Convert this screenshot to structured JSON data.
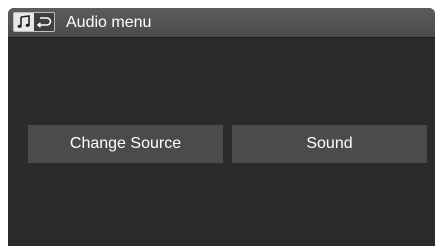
{
  "header": {
    "title": "Audio menu",
    "icon_main": "music-note-icon",
    "icon_back": "back-arrow-icon"
  },
  "menu": {
    "buttons": [
      {
        "label": "Change Source"
      },
      {
        "label": "Sound"
      }
    ]
  },
  "colors": {
    "screen_bg": "#2b2b2b",
    "header_bg": "#4f4f4f",
    "button_bg": "#4b4b4b",
    "text": "#ffffff"
  }
}
